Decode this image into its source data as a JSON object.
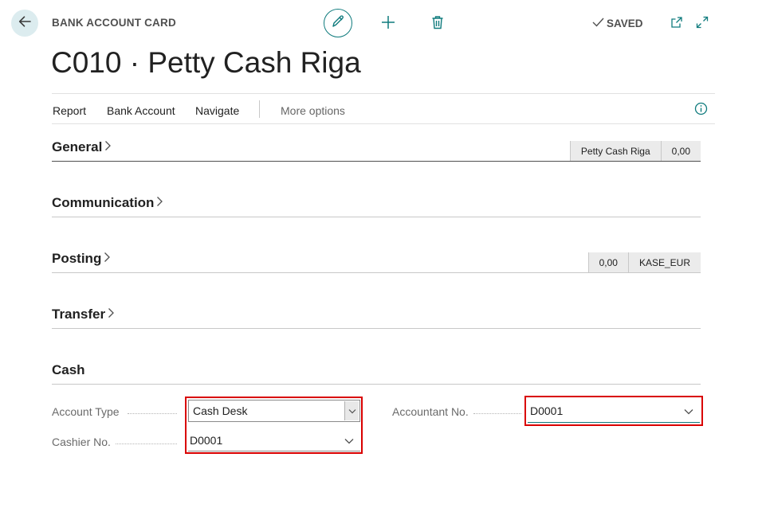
{
  "header": {
    "card_type": "BANK ACCOUNT CARD",
    "title": "C010 · Petty Cash Riga",
    "saved_label": "SAVED",
    "icons": [
      "back-arrow-icon",
      "pencil-icon",
      "plus-icon",
      "trash-icon",
      "checkmark-icon",
      "open-new-window-icon",
      "expand-icon"
    ]
  },
  "action_bar": {
    "items": [
      "Report",
      "Bank Account",
      "Navigate"
    ],
    "more_options": "More options",
    "info_icon": "info-icon"
  },
  "sections": {
    "general": {
      "title": "General",
      "chips": [
        "Petty Cash Riga",
        "0,00"
      ]
    },
    "communication": {
      "title": "Communication"
    },
    "posting": {
      "title": "Posting",
      "chips": [
        "0,00",
        "KASE_EUR"
      ]
    },
    "transfer": {
      "title": "Transfer"
    },
    "cash": {
      "title": "Cash"
    }
  },
  "cash_fields": {
    "account_type": {
      "label": "Account Type",
      "value": "Cash Desk"
    },
    "cashier_no": {
      "label": "Cashier No.",
      "value": "D0001"
    },
    "accountant_no": {
      "label": "Accountant No.",
      "value": "D0001"
    }
  },
  "colors": {
    "accent": "#0f7b7d",
    "highlight": "#d90000",
    "back_button_bg": "#dcecef"
  }
}
